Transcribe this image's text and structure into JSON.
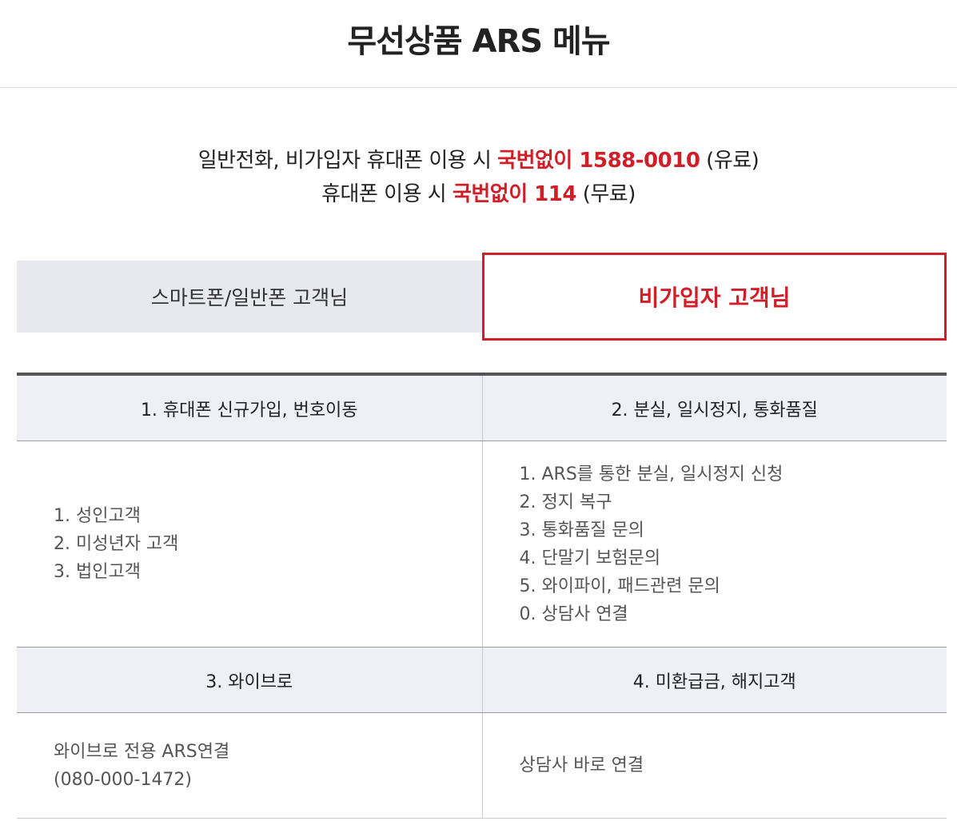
{
  "header": {
    "title": "무선상품 ARS 메뉴"
  },
  "notice": {
    "line1_prefix": "일반전화, 비가입자 휴대폰 이용 시 ",
    "line1_highlight": "국번없이 1588-0010",
    "line1_suffix": " (유료)",
    "line2_prefix": "휴대폰 이용 시 ",
    "line2_highlight": "국번없이 114",
    "line2_suffix": " (무료)",
    "highlight_color": "#d11f2a"
  },
  "tabs": [
    {
      "label": "스마트폰/일반폰 고객님",
      "active": false
    },
    {
      "label": "비가입자 고객님",
      "active": true
    }
  ],
  "menu": {
    "sections": [
      {
        "title": "1. 휴대폰 신규가입, 번호이동",
        "items": [
          "1. 성인고객",
          "2. 미성년자 고객",
          "3. 법인고객"
        ]
      },
      {
        "title": "2. 분실, 일시정지, 통화품질",
        "items": [
          "1. ARS를 통한 분실, 일시정지 신청",
          "2. 정지 복구",
          "3. 통화품질 문의",
          "4. 단말기 보험문의",
          "5. 와이파이, 패드관련 문의",
          "0. 상담사 연결"
        ]
      },
      {
        "title": "3. 와이브로",
        "items": [
          "와이브로 전용 ARS연결",
          "(080-000-1472)"
        ]
      },
      {
        "title": "4. 미환급금, 해지고객",
        "items": [
          "상담사 바로 연결"
        ]
      }
    ]
  }
}
